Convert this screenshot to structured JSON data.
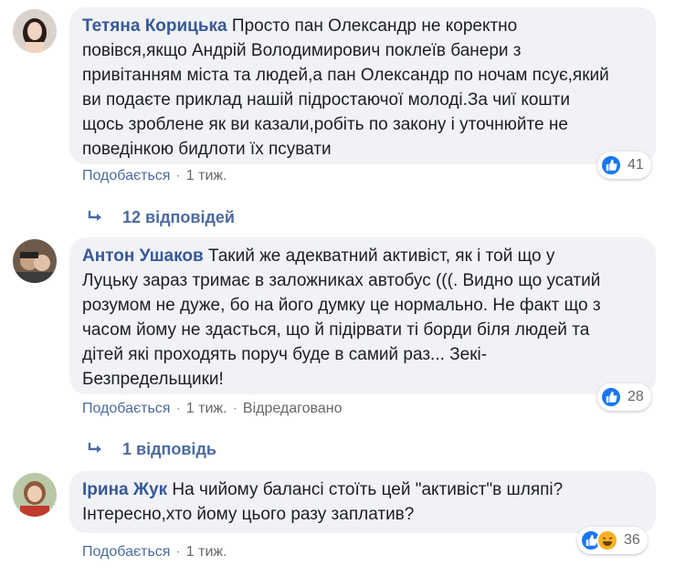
{
  "comments": [
    {
      "author": "Тетяна Корицька",
      "text_lines": [
        "Просто пан Олександр не коректно",
        "повівся,якщо Андрій Володимирович поклеїв банери з",
        "привітанням міста та людей,а пан Олександр по ночам псує,який",
        "ви подаєте приклад нашій підростаючої молоді.За чиї кошти",
        "щось зроблене як ви казали,робіть по закону і уточнюйте не",
        "поведінкою бидлоти їх псувати"
      ],
      "like_label": "Подобається",
      "time": "1 тиж.",
      "edited": "",
      "reaction_count": "41",
      "replies_label": "12 відповідей"
    },
    {
      "author": "Антон Ушаков",
      "text_lines": [
        "Такий же адекватний активіст, як і той що у",
        "Луцьку зараз тримає в заложниках автобус (((. Видно що усатий",
        "розумом не дуже, бо на його думку це нормально. Не факт що з",
        "часом йому не здасться, що й підірвати ті борди біля людей та",
        "дітей які проходять поруч буде в самий раз... Зекі-",
        "Безпредельщики!"
      ],
      "like_label": "Подобається",
      "time": "1 тиж.",
      "edited": "Відредаговано",
      "reaction_count": "28",
      "replies_label": "1 відповідь"
    },
    {
      "author": "Ірина Жук",
      "text_lines": [
        "На чийому балансі стоїть цей \"активіст\"в шляпі?",
        "Інтересно,хто йому цього разу заплатив?"
      ],
      "like_label": "Подобається",
      "time": "1 тиж.",
      "edited": "",
      "reaction_count": "36",
      "replies_label": ""
    }
  ],
  "colors": {
    "author": "#385898",
    "bubble": "#f0f2f5",
    "meta": "#65676b",
    "like_blue": "#1877f2",
    "haha_yellow": "#f7b125"
  },
  "icons": [
    "thumbs-up-icon",
    "haha-icon",
    "reply-arrow-icon"
  ]
}
